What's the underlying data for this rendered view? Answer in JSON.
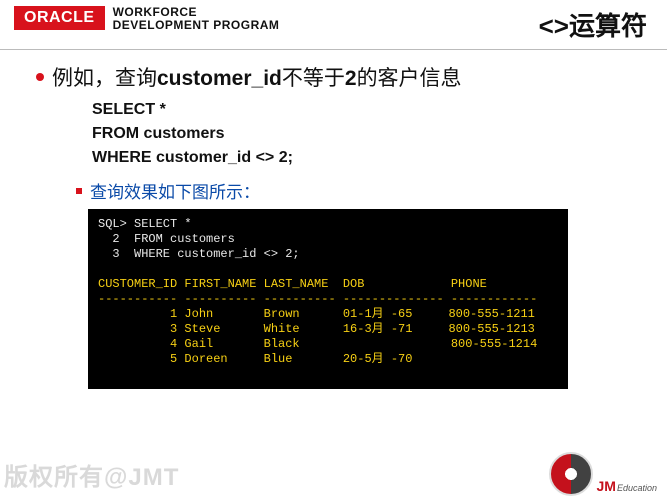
{
  "header": {
    "oracle": "ORACLE",
    "wdp_line1": "WORKFORCE",
    "wdp_line2": "DEVELOPMENT PROGRAM",
    "title": "<>运算符"
  },
  "bullet": {
    "pre": "例如，查询",
    "bold1": "customer_id",
    "mid": "不等于",
    "bold2": "2",
    "post": "的客户信息"
  },
  "sql": {
    "l1": "SELECT *",
    "l2": "FROM customers",
    "l3": "WHERE customer_id <> 2;"
  },
  "sub": "查询效果如下图所示：",
  "terminal": {
    "lines_white": [
      "SQL> SELECT *",
      "  2  FROM customers",
      "  3  WHERE customer_id <> 2;"
    ],
    "header": "CUSTOMER_ID FIRST_NAME LAST_NAME  DOB            PHONE",
    "divider": "----------- ---------- ---------- -------------- ------------",
    "rows": [
      "          1 John       Brown      01-1月 -65     800-555-1211",
      "          3 Steve      White      16-3月 -71     800-555-1213",
      "          4 Gail       Black                     800-555-1214",
      "          5 Doreen     Blue       20-5月 -70"
    ]
  },
  "footer": {
    "watermark": "版权所有@JMT",
    "brand1": "JM",
    "brand2": "Education"
  }
}
